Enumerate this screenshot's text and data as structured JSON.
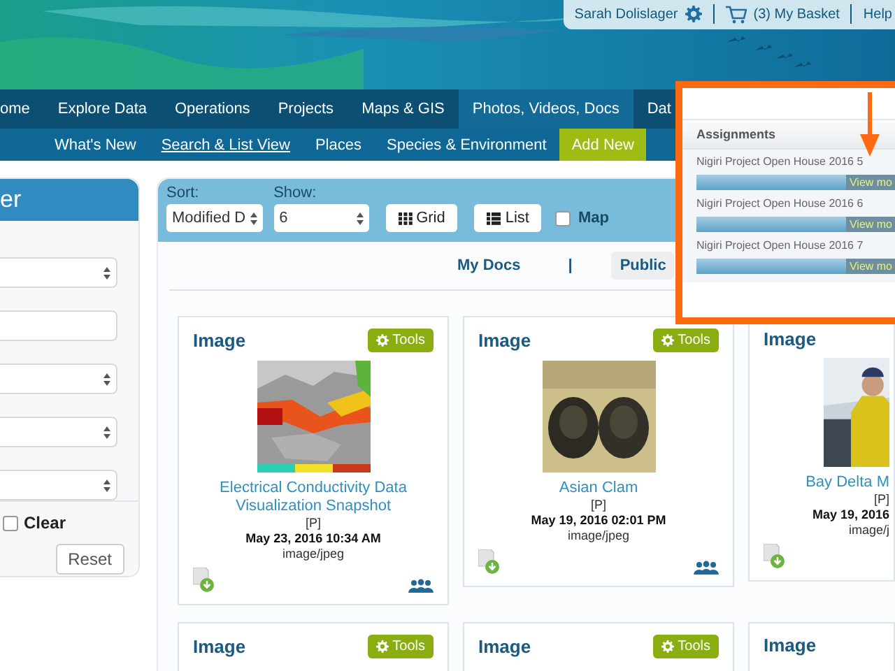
{
  "header": {
    "user": "Sarah Dolislager",
    "basket": "(3) My Basket",
    "help": "Help"
  },
  "main_nav": [
    {
      "label": "ome",
      "selected": false
    },
    {
      "label": "Explore Data",
      "selected": false
    },
    {
      "label": "Operations",
      "selected": false
    },
    {
      "label": "Projects",
      "selected": false
    },
    {
      "label": "Maps & GIS",
      "selected": false
    },
    {
      "label": "Photos, Videos, Docs",
      "selected": true
    },
    {
      "label": "Dat",
      "selected": false
    }
  ],
  "sub_nav": [
    {
      "label": "What's New",
      "selected": false,
      "kind": "link"
    },
    {
      "label": "Search & List View",
      "selected": true,
      "kind": "link"
    },
    {
      "label": "Places",
      "selected": false,
      "kind": "link"
    },
    {
      "label": "Species & Environment",
      "selected": false,
      "kind": "link"
    },
    {
      "label": "Add New",
      "selected": false,
      "kind": "action"
    }
  ],
  "filter_panel": {
    "title": "er",
    "fields": [
      {
        "kind": "select"
      },
      {
        "kind": "input"
      },
      {
        "kind": "select"
      },
      {
        "kind": "select"
      },
      {
        "kind": "select"
      }
    ],
    "clear": {
      "label": "Clear",
      "checked": false
    },
    "reset": "Reset"
  },
  "toolbar": {
    "sort_label": "Sort:",
    "sort_value": "Modified D",
    "show_label": "Show:",
    "show_value": "6",
    "buttons": [
      {
        "label": "Grid",
        "kind": "grid"
      },
      {
        "label": "List",
        "kind": "list"
      }
    ],
    "map": {
      "label": "Map",
      "checked": false
    }
  },
  "doc_tabs": [
    {
      "label": "My Docs",
      "selected": false
    },
    {
      "label": "Public",
      "selected": true
    }
  ],
  "doc_tabs_separator": "|",
  "cards": [
    {
      "type": "Image",
      "tools": "Tools",
      "title": "Electrical Conductivity Data Visualization Snapshot",
      "access": "[P]",
      "date": "May 23, 2016 10:34 AM",
      "mime": "image/jpeg",
      "shared": true
    },
    {
      "type": "Image",
      "tools": "Tools",
      "title": "Asian Clam",
      "access": "[P]",
      "date": "May 19, 2016 02:01 PM",
      "mime": "image/jpeg",
      "shared": true
    },
    {
      "type": "Image",
      "title": "Bay Delta M",
      "access": "[P]",
      "date": "May 19, 2016",
      "mime": "image/j",
      "shared": false
    }
  ],
  "cards_row2": [
    {
      "type": "Image",
      "tools": "Tools"
    },
    {
      "type": "Image",
      "tools": "Tools"
    },
    {
      "type": "Image"
    }
  ],
  "callout": {
    "title": "Assignments",
    "items": [
      {
        "name": "Nigiri Project Open House 2016 5",
        "button": "View mo"
      },
      {
        "name": "Nigiri Project Open House 2016 6",
        "button": "View mo"
      },
      {
        "name": "Nigiri Project Open House 2016 7",
        "button": "View mo"
      }
    ]
  }
}
